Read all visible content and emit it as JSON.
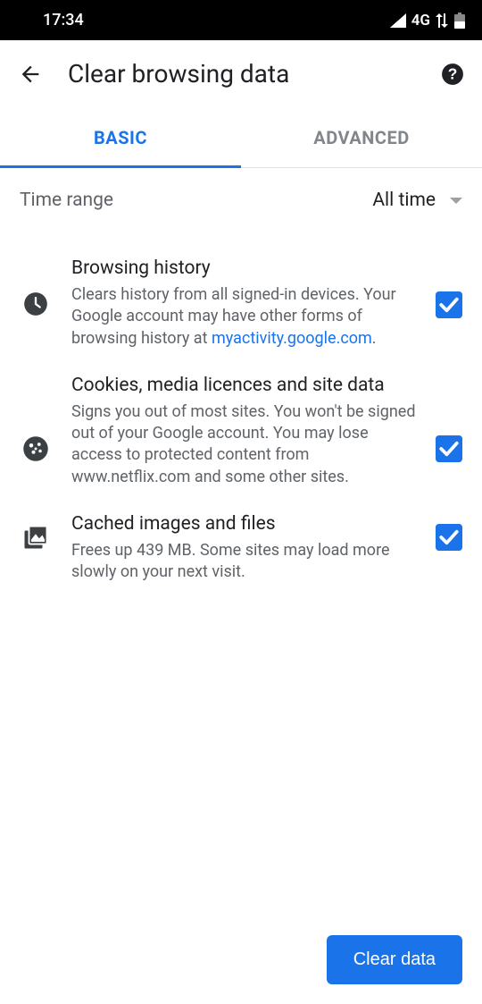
{
  "status_bar": {
    "time": "17:34",
    "network": "4G"
  },
  "header": {
    "title": "Clear browsing data"
  },
  "tabs": {
    "basic": "BASIC",
    "advanced": "ADVANCED"
  },
  "time_range": {
    "label": "Time range",
    "value": "All time"
  },
  "options": {
    "history": {
      "title": "Browsing history",
      "desc": "Clears history from all signed-in devices. Your Google account may have other forms of browsing history at ",
      "link": "myactivity.google.com",
      "period": "."
    },
    "cookies": {
      "title": "Cookies, media licences and site data",
      "desc": "Signs you out of most sites. You won't be signed out of your Google account. You may lose access to protected content from www.netflix.com and some other sites."
    },
    "cache": {
      "title": "Cached images and files",
      "desc": "Frees up 439 MB. Some sites may load more slowly on your next visit."
    }
  },
  "clear_button": "Clear data"
}
